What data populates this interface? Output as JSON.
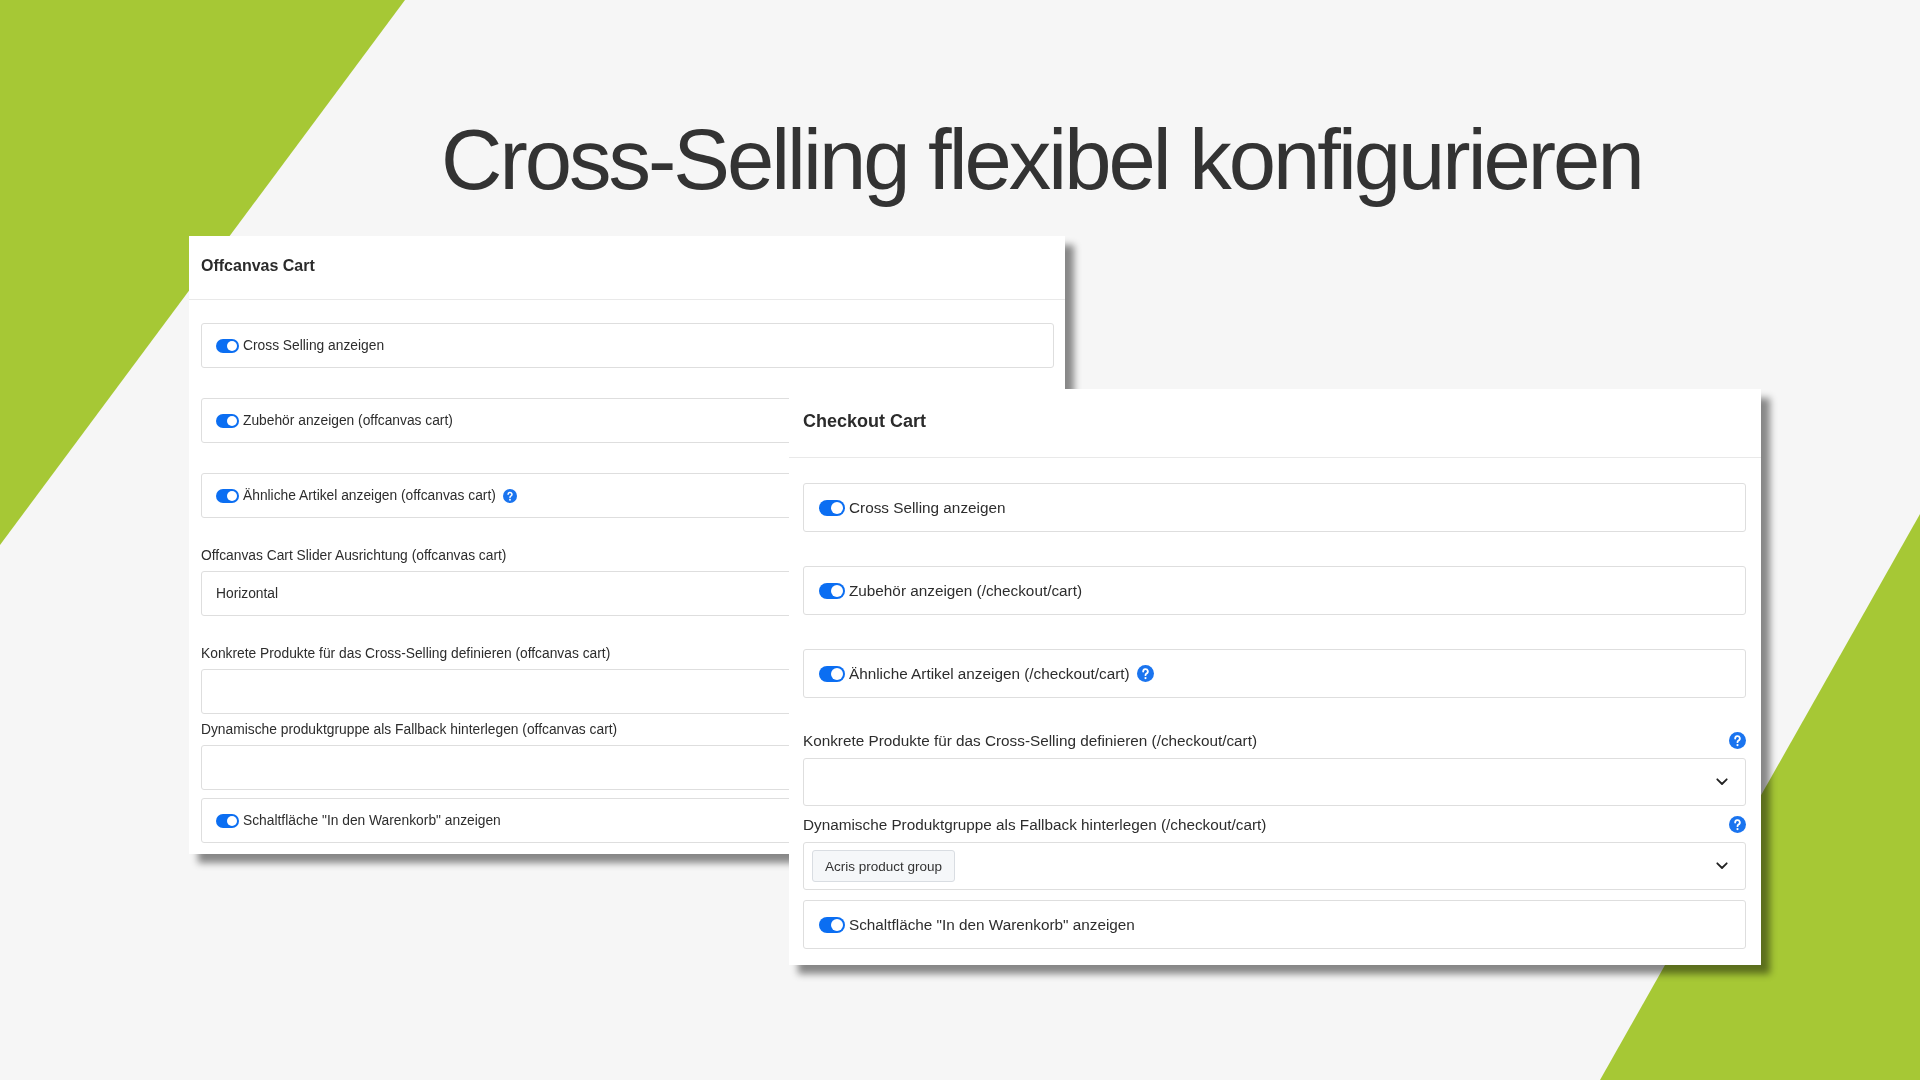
{
  "slide": {
    "title": "Cross-Selling flexibel konfigurieren"
  },
  "panels": [
    {
      "title": "Offcanvas Cart",
      "fields": [
        {
          "kind": "toggle",
          "label": "Cross Selling anzeigen",
          "on": true,
          "help": false
        },
        {
          "kind": "toggle",
          "label": "Zubehör anzeigen (offcanvas cart)",
          "on": true,
          "help": false
        },
        {
          "kind": "toggle",
          "label": "Ähnliche Artikel anzeigen (offcanvas cart)",
          "on": true,
          "help": true
        },
        {
          "kind": "input",
          "label": "Offcanvas Cart Slider Ausrichtung (offcanvas cart)",
          "value": "Horizontal",
          "help": false
        },
        {
          "kind": "input",
          "label": "Konkrete Produkte für das Cross-Selling definieren (offcanvas cart)",
          "help": false
        },
        {
          "kind": "input",
          "label": "Dynamische produktgruppe als Fallback hinterlegen (offcanvas cart)",
          "help": false
        },
        {
          "kind": "toggle",
          "label": "Schaltfläche \"In den Warenkorb\" anzeigen",
          "on": true,
          "help": false
        }
      ]
    },
    {
      "title": "Checkout Cart",
      "fields": [
        {
          "kind": "toggle",
          "label": "Cross Selling anzeigen",
          "on": true,
          "help": false
        },
        {
          "kind": "toggle",
          "label": "Zubehör anzeigen (/checkout/cart)",
          "on": true,
          "help": false
        },
        {
          "kind": "toggle",
          "label": "Ähnliche Artikel anzeigen (/checkout/cart)",
          "on": true,
          "help": true
        },
        {
          "kind": "select",
          "label": "Konkrete Produkte für das Cross-Selling definieren (/checkout/cart)",
          "help": true
        },
        {
          "kind": "select",
          "label": "Dynamische Produktgruppe als Fallback hinterlegen (/checkout/cart)",
          "tags": [
            "Acris product group"
          ],
          "help": true
        },
        {
          "kind": "toggle",
          "label": "Schaltfläche \"In den Warenkorb\" anzeigen",
          "on": true,
          "help": false
        }
      ]
    }
  ]
}
